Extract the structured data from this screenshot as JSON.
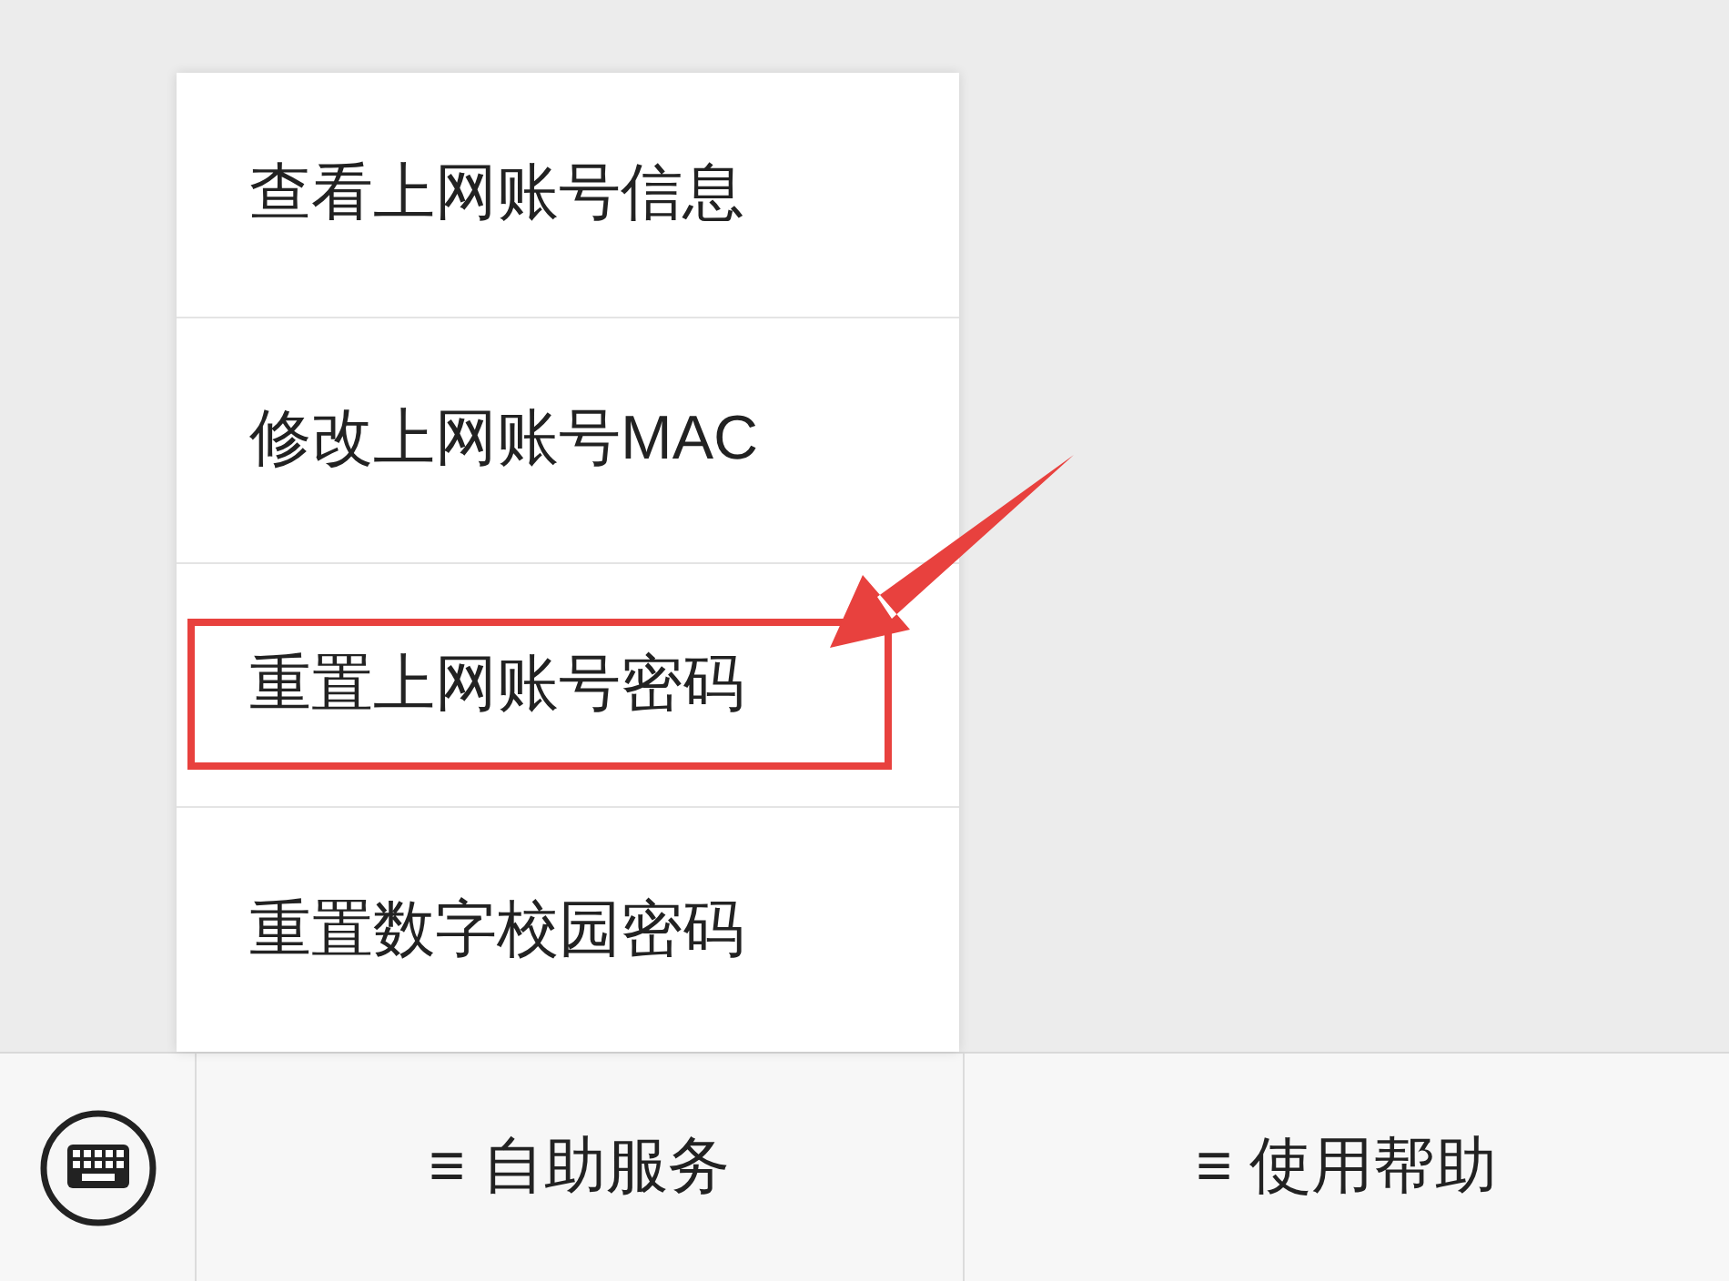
{
  "menu": {
    "items": [
      {
        "label": "查看上网账号信息",
        "highlighted": false
      },
      {
        "label": "修改上网账号MAC",
        "highlighted": false
      },
      {
        "label": "重置上网账号密码",
        "highlighted": true
      },
      {
        "label": "重置数字校园密码",
        "highlighted": false
      }
    ]
  },
  "bottom_bar": {
    "tabs": [
      {
        "label": "≡ 自助服务"
      },
      {
        "label": "≡ 使用帮助"
      }
    ]
  }
}
